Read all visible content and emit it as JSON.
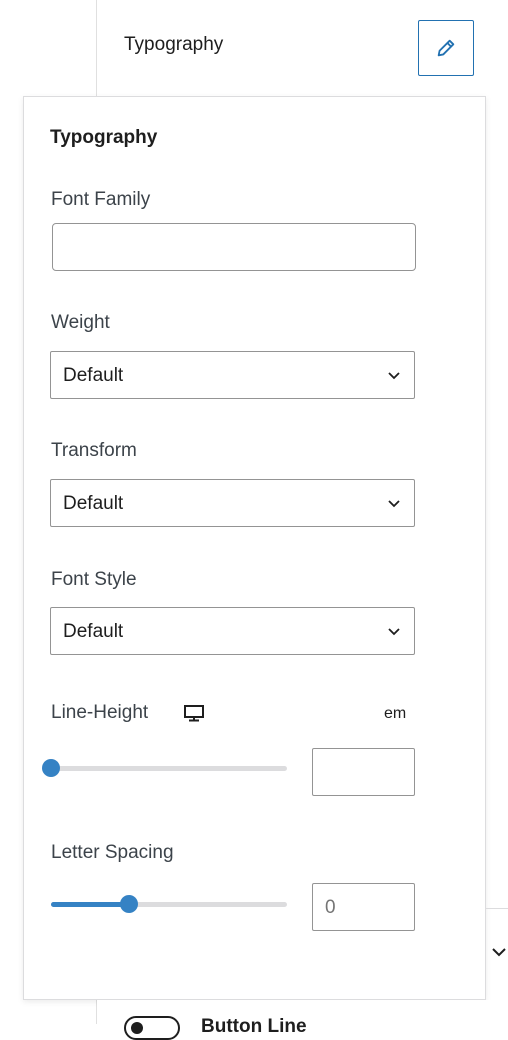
{
  "header": {
    "title": "Typography"
  },
  "popover": {
    "title": "Typography",
    "font_family": {
      "label": "Font Family",
      "value": "",
      "placeholder": ""
    },
    "weight": {
      "label": "Weight",
      "value": "Default"
    },
    "transform": {
      "label": "Transform",
      "value": "Default"
    },
    "font_style": {
      "label": "Font Style",
      "value": "Default"
    },
    "line_height": {
      "label": "Line-Height",
      "unit": "em",
      "value": "",
      "slider_fraction": 0.0,
      "device_icon": "desktop-icon"
    },
    "letter_spacing": {
      "label": "Letter Spacing",
      "value": "0",
      "slider_fraction": 0.33
    }
  },
  "below": {
    "label": "Button Line"
  },
  "colors": {
    "accent": "#3582c4",
    "border": "#949494",
    "button_border": "#2271b1"
  },
  "icons": {
    "edit": "pencil-icon",
    "select": "chevron-down-icon",
    "panel": "chevron-down-icon"
  }
}
